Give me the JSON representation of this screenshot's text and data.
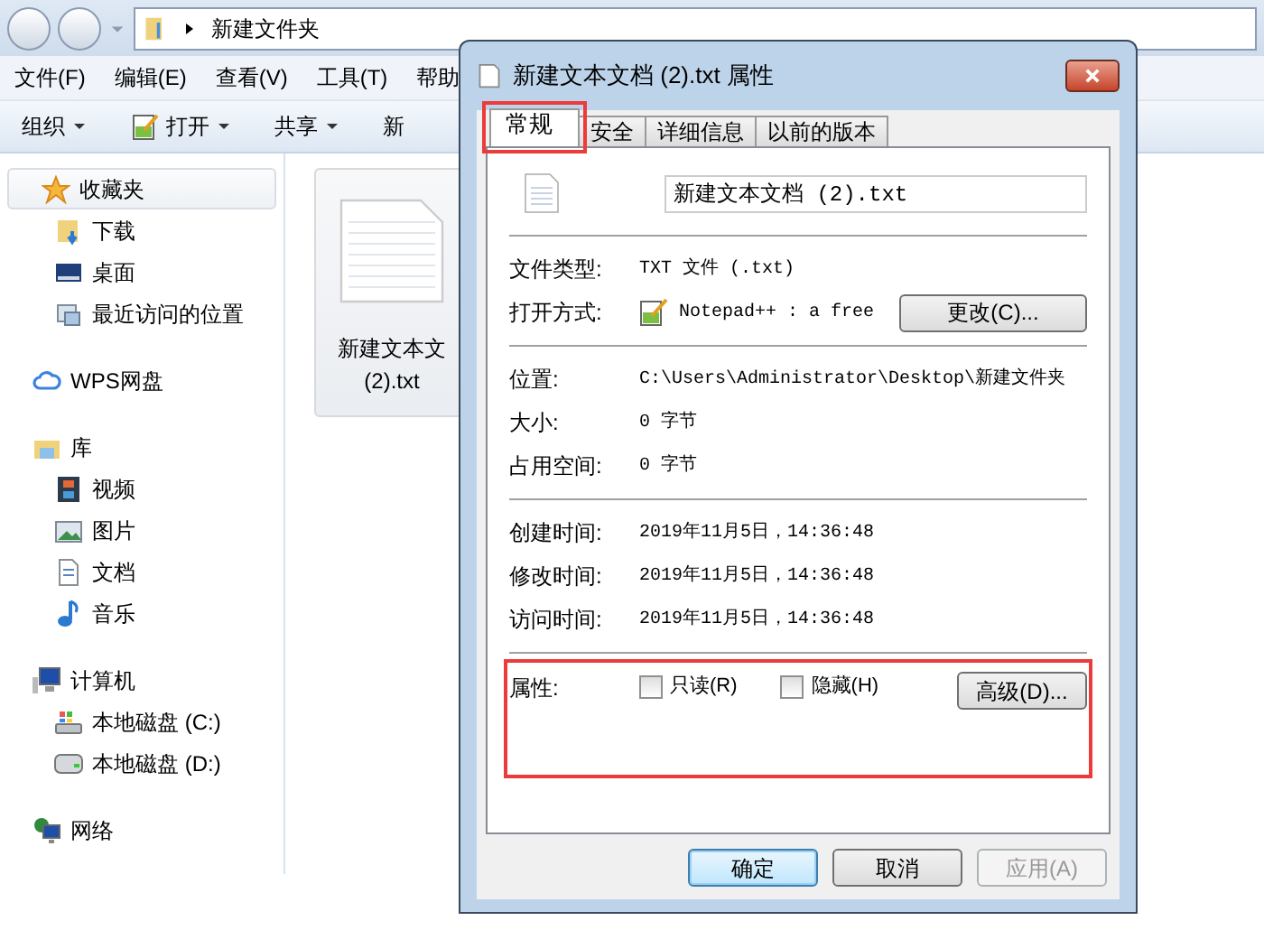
{
  "explorer": {
    "path": [
      "新建文件夹"
    ],
    "menu": [
      "文件(F)",
      "编辑(E)",
      "查看(V)",
      "工具(T)",
      "帮助"
    ],
    "toolbar": [
      {
        "label": "组织",
        "kind": "dropdown"
      },
      {
        "label": "打开",
        "kind": "open"
      },
      {
        "label": "共享",
        "kind": "dropdown"
      },
      {
        "label": "新",
        "kind": "plain"
      }
    ],
    "sidebar": [
      {
        "label": "收藏夹",
        "kind": "star",
        "selected": true,
        "children": [
          {
            "label": "下载",
            "kind": "download",
            "selected": false
          },
          {
            "label": "桌面",
            "kind": "desktop",
            "selected": false
          },
          {
            "label": "最近访问的位置",
            "kind": "recent",
            "selected": false
          }
        ]
      },
      {
        "label": "WPS网盘",
        "kind": "cloud",
        "selected": false
      },
      {
        "label": "库",
        "kind": "library",
        "selected": false,
        "children": [
          {
            "label": "视频",
            "kind": "video",
            "selected": false
          },
          {
            "label": "图片",
            "kind": "image",
            "selected": false
          },
          {
            "label": "文档",
            "kind": "doc",
            "selected": false
          },
          {
            "label": "音乐",
            "kind": "music",
            "selected": false
          }
        ]
      },
      {
        "label": "计算机",
        "kind": "computer",
        "selected": false,
        "children": [
          {
            "label": "本地磁盘 (C:)",
            "kind": "sysdisk",
            "selected": false
          },
          {
            "label": "本地磁盘 (D:)",
            "kind": "disk",
            "selected": false
          }
        ]
      },
      {
        "label": "网络",
        "kind": "network",
        "selected": false
      }
    ],
    "files": [
      {
        "name_lines": [
          "新建文本文",
          "(2).txt"
        ],
        "selected": true
      }
    ]
  },
  "dialog": {
    "title": "新建文本文档 (2).txt 属性",
    "tabs": [
      {
        "label": "常规",
        "selected": true,
        "highlighted": true
      },
      {
        "label": "安全",
        "selected": false,
        "highlighted": false
      },
      {
        "label": "详细信息",
        "selected": false,
        "highlighted": false
      },
      {
        "label": "以前的版本",
        "selected": false,
        "highlighted": false
      }
    ],
    "file_name": "新建文本文档 (2).txt",
    "groups": [
      [
        {
          "label": "文件类型:",
          "value": "TXT 文件 (.txt)"
        },
        {
          "label": "打开方式:",
          "value": "Notepad++ : a free",
          "kind": "app",
          "button": "更改(C)..."
        }
      ],
      [
        {
          "label": "位置:",
          "value": "C:\\Users\\Administrator\\Desktop\\新建文件夹"
        },
        {
          "label": "大小:",
          "value": "0 字节"
        },
        {
          "label": "占用空间:",
          "value": "0 字节"
        }
      ],
      [
        {
          "label": "创建时间:",
          "value": "2019年11月5日，14:36:48"
        },
        {
          "label": "修改时间:",
          "value": "2019年11月5日，14:36:48"
        },
        {
          "label": "访问时间:",
          "value": "2019年11月5日，14:36:48"
        }
      ]
    ],
    "attributes": {
      "label": "属性:",
      "highlighted": true,
      "checkboxes": [
        {
          "label": "只读(R)",
          "checked": false
        },
        {
          "label": "隐藏(H)",
          "checked": false
        }
      ],
      "button": "高级(D)..."
    },
    "buttons": [
      {
        "label": "确定",
        "default": true,
        "disabled": false
      },
      {
        "label": "取消",
        "default": false,
        "disabled": false
      },
      {
        "label": "应用(A)",
        "default": false,
        "disabled": true
      }
    ]
  }
}
